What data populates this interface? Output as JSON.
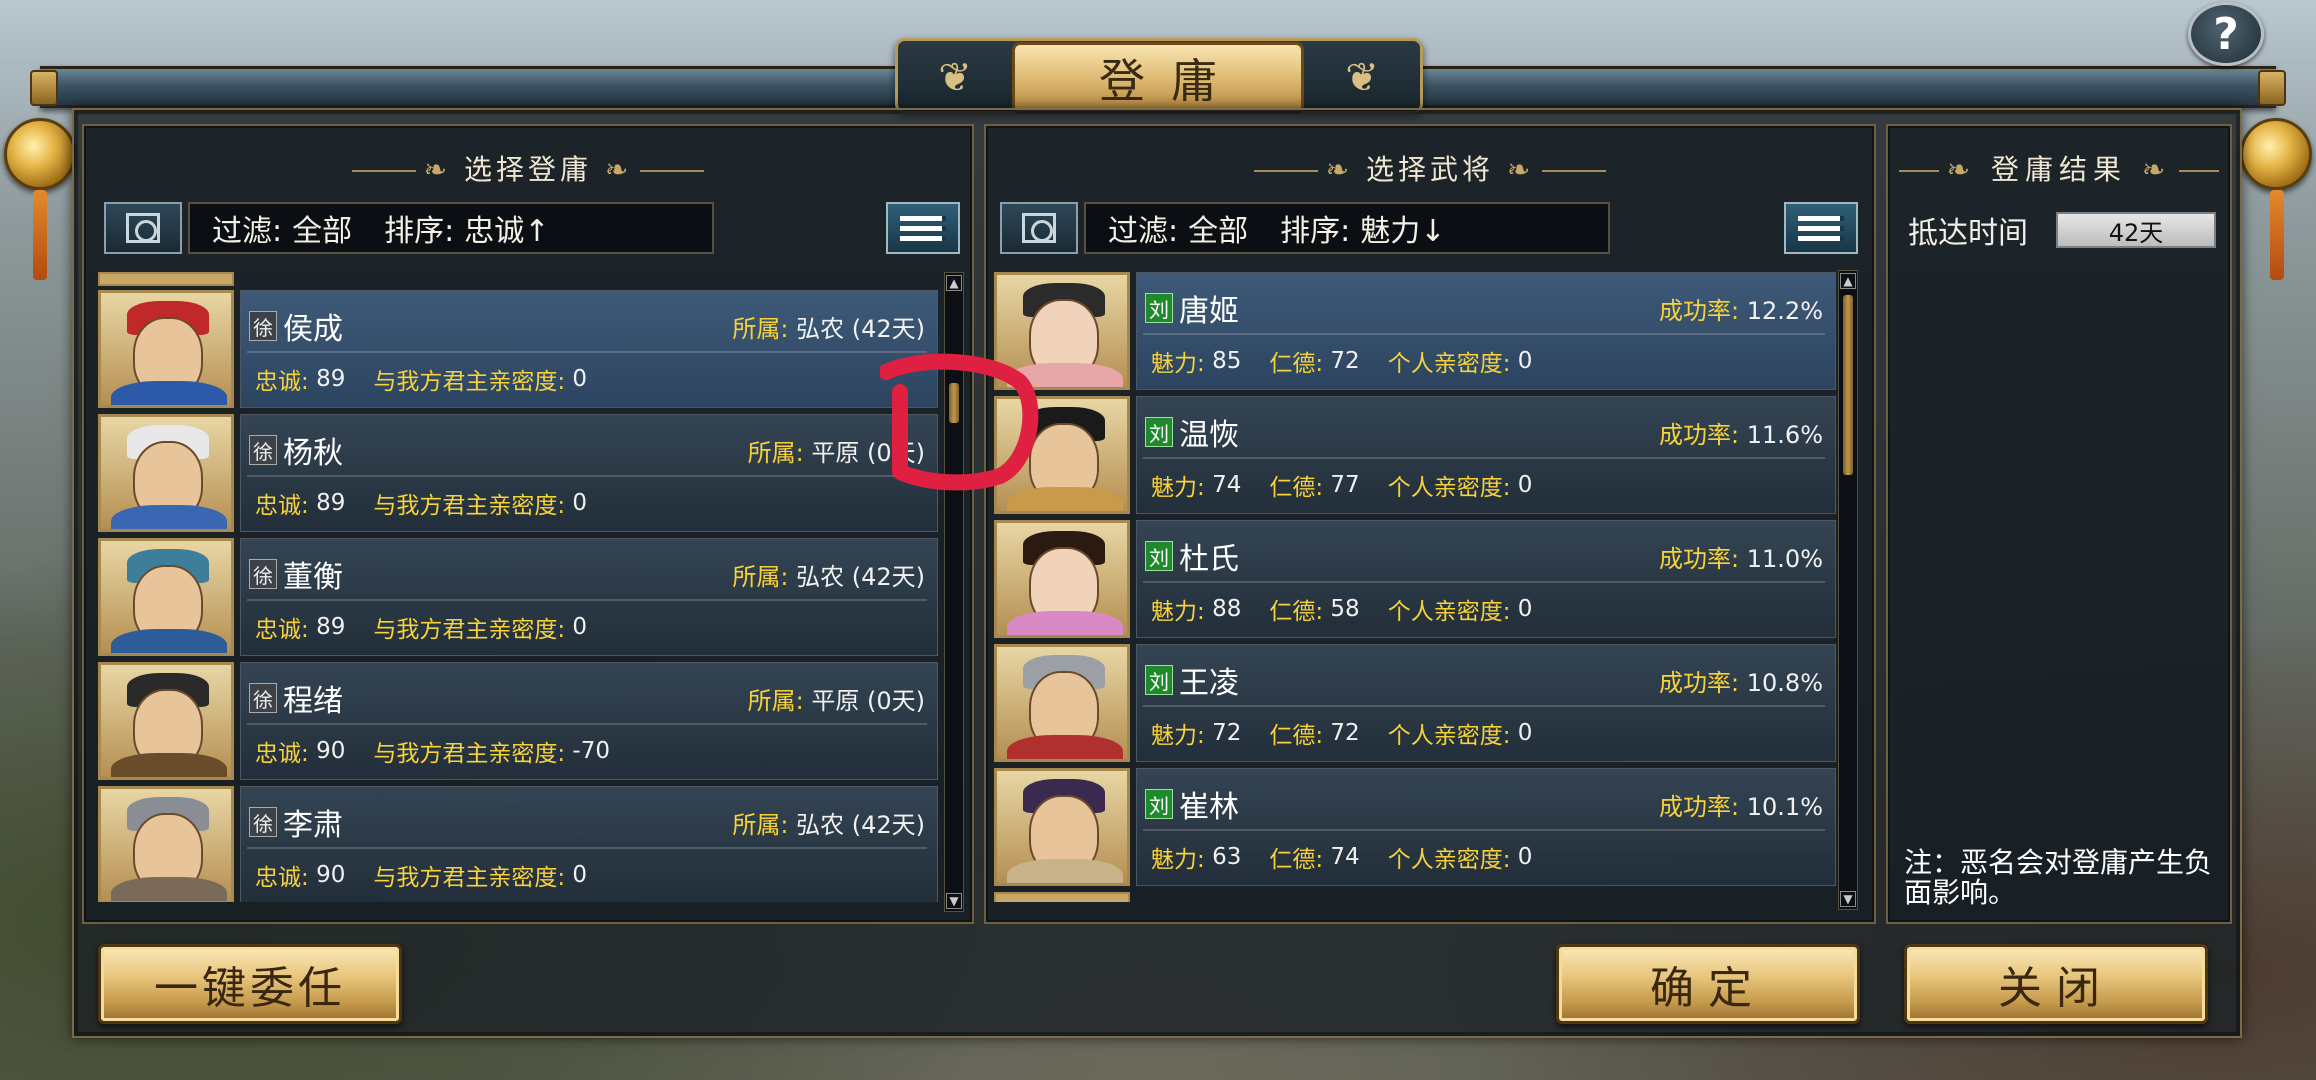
{
  "title": "登庸",
  "help_label": "?",
  "left_panel": {
    "header": "选择登庸",
    "filter_label": "过滤:",
    "filter_value": "全部",
    "sort_label": "排序:",
    "sort_value": "忠诚↑",
    "rows": [
      {
        "faction": "徐",
        "name": "侯成",
        "affil_label": "所属:",
        "affil_value": "弘农 (42天)",
        "loyalty_label": "忠诚:",
        "loyalty": "89",
        "intimacy_label": "与我方君主亲密度:",
        "intimacy": "0"
      },
      {
        "faction": "徐",
        "name": "杨秋",
        "affil_label": "所属:",
        "affil_value": "平原 (0天)",
        "loyalty_label": "忠诚:",
        "loyalty": "89",
        "intimacy_label": "与我方君主亲密度:",
        "intimacy": "0"
      },
      {
        "faction": "徐",
        "name": "董衡",
        "affil_label": "所属:",
        "affil_value": "弘农 (42天)",
        "loyalty_label": "忠诚:",
        "loyalty": "89",
        "intimacy_label": "与我方君主亲密度:",
        "intimacy": "0"
      },
      {
        "faction": "徐",
        "name": "程绪",
        "affil_label": "所属:",
        "affil_value": "平原 (0天)",
        "loyalty_label": "忠诚:",
        "loyalty": "90",
        "intimacy_label": "与我方君主亲密度:",
        "intimacy": "-70"
      },
      {
        "faction": "徐",
        "name": "李肃",
        "affil_label": "所属:",
        "affil_value": "弘农 (42天)",
        "loyalty_label": "忠诚:",
        "loyalty": "90",
        "intimacy_label": "与我方君主亲密度:",
        "intimacy": "0"
      }
    ]
  },
  "middle_panel": {
    "header": "选择武将",
    "filter_label": "过滤:",
    "filter_value": "全部",
    "sort_label": "排序:",
    "sort_value": "魅力↓",
    "rows": [
      {
        "faction": "刘",
        "name": "唐姬",
        "rate_label": "成功率:",
        "rate": "12.2%",
        "charm_label": "魅力:",
        "charm": "85",
        "virtue_label": "仁德:",
        "virtue": "72",
        "intimacy_label": "个人亲密度:",
        "intimacy": "0"
      },
      {
        "faction": "刘",
        "name": "温恢",
        "rate_label": "成功率:",
        "rate": "11.6%",
        "charm_label": "魅力:",
        "charm": "74",
        "virtue_label": "仁德:",
        "virtue": "77",
        "intimacy_label": "个人亲密度:",
        "intimacy": "0"
      },
      {
        "faction": "刘",
        "name": "杜氏",
        "rate_label": "成功率:",
        "rate": "11.0%",
        "charm_label": "魅力:",
        "charm": "88",
        "virtue_label": "仁德:",
        "virtue": "58",
        "intimacy_label": "个人亲密度:",
        "intimacy": "0"
      },
      {
        "faction": "刘",
        "name": "王凌",
        "rate_label": "成功率:",
        "rate": "10.8%",
        "charm_label": "魅力:",
        "charm": "72",
        "virtue_label": "仁德:",
        "virtue": "72",
        "intimacy_label": "个人亲密度:",
        "intimacy": "0"
      },
      {
        "faction": "刘",
        "name": "崔林",
        "rate_label": "成功率:",
        "rate": "10.1%",
        "charm_label": "魅力:",
        "charm": "63",
        "virtue_label": "仁德:",
        "virtue": "74",
        "intimacy_label": "个人亲密度:",
        "intimacy": "0"
      }
    ]
  },
  "result_panel": {
    "header": "登庸结果",
    "arrival_label": "抵达时间",
    "arrival_value": "42天",
    "note": "注：恶名会对登庸产生负面影响。"
  },
  "buttons": {
    "delegate": "一键委任",
    "confirm": "确定",
    "close": "关闭"
  },
  "colors": {
    "accent_yellow": "#f7d23a",
    "gold_button": "#e7c57c",
    "annotation_red": "#e02040"
  }
}
